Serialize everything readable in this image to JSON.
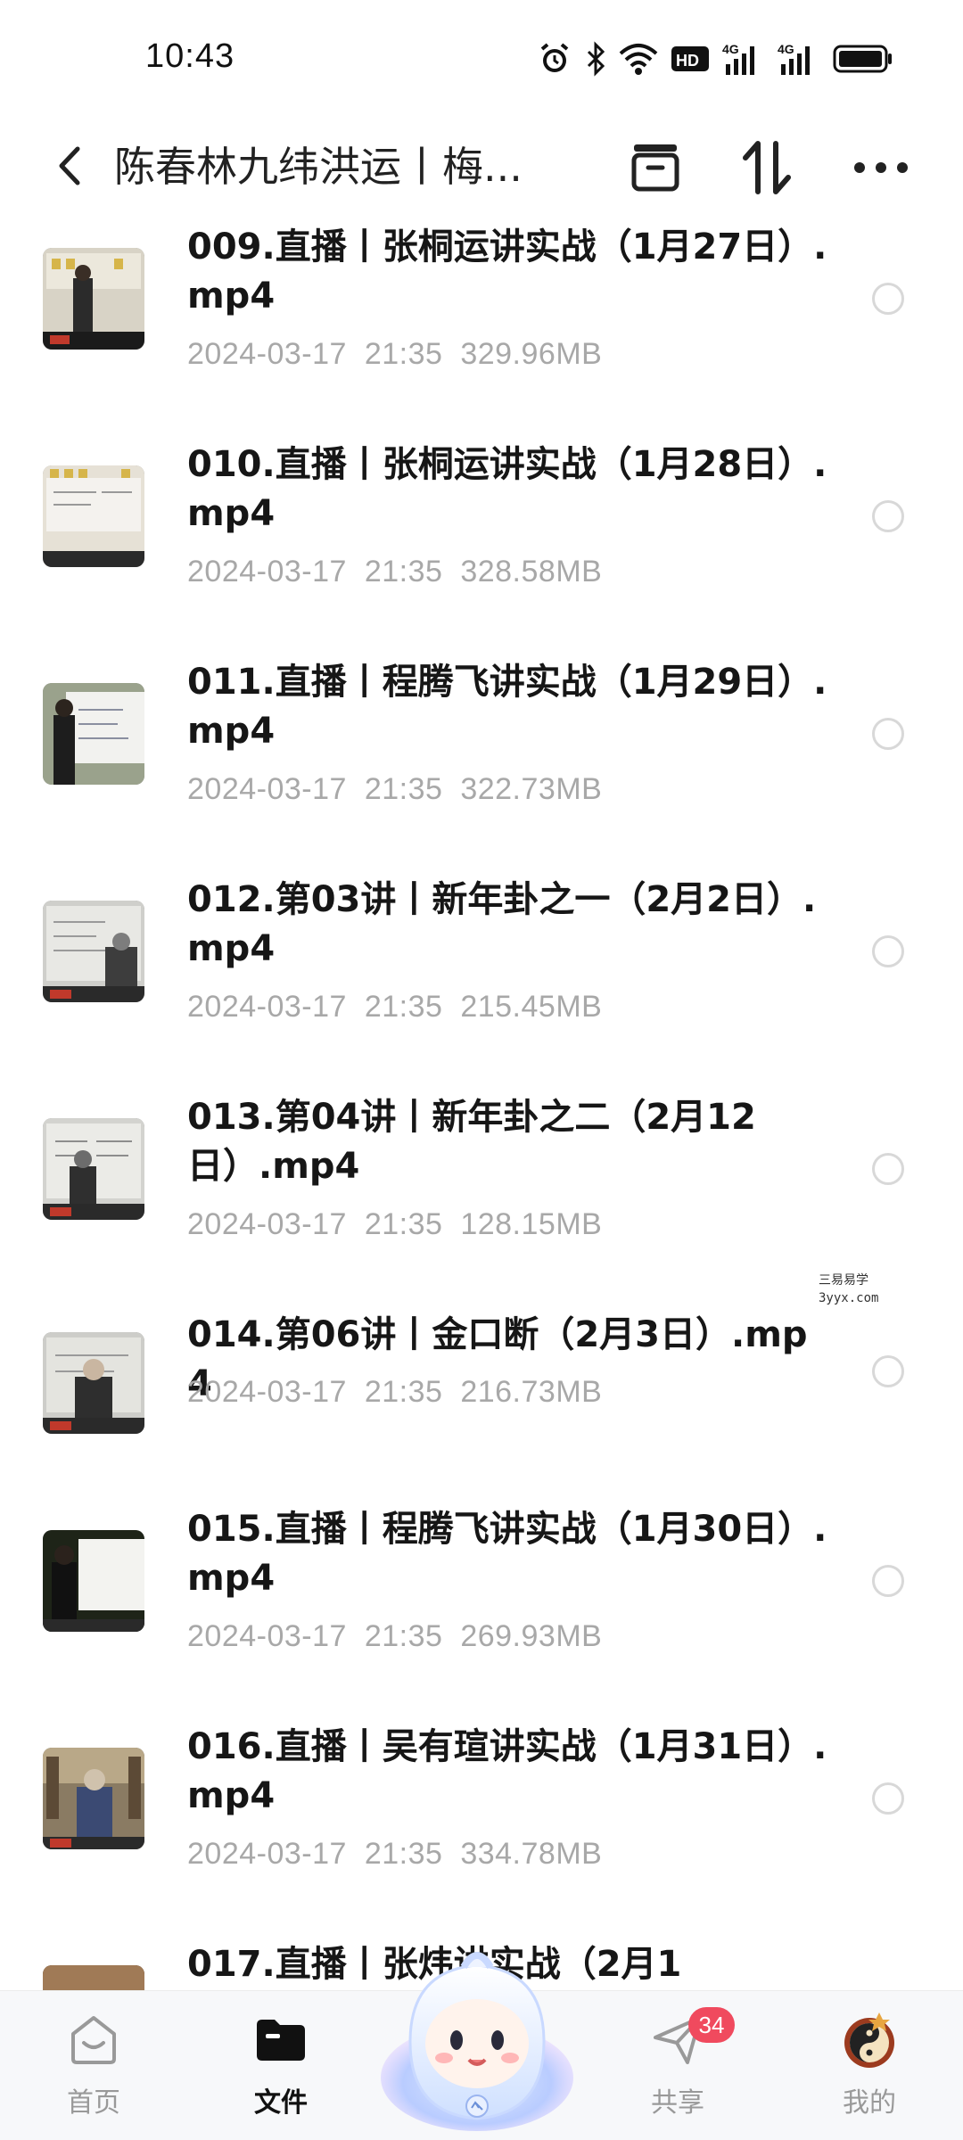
{
  "status_bar": {
    "time": "10:43",
    "icons": [
      "alarm-icon",
      "bluetooth-icon",
      "wifi-icon",
      "hd-icon",
      "signal-4g-icon",
      "signal-4g-icon",
      "battery-icon"
    ]
  },
  "header": {
    "title": "陈春林九纬洪运丨梅...",
    "icons": [
      "back-icon",
      "archive-icon",
      "sort-icon",
      "more-icon"
    ]
  },
  "files": [
    {
      "name": "009.直播丨张桐运讲实战（1月27日）.mp4",
      "date": "2024-03-17",
      "time": "21:35",
      "size": "329.96MB"
    },
    {
      "name": "010.直播丨张桐运讲实战（1月28日）.mp4",
      "date": "2024-03-17",
      "time": "21:35",
      "size": "328.58MB"
    },
    {
      "name": "011.直播丨程腾飞讲实战（1月29日）.mp4",
      "date": "2024-03-17",
      "time": "21:35",
      "size": "322.73MB"
    },
    {
      "name": "012.第03讲丨新年卦之一（2月2日）.mp4",
      "date": "2024-03-17",
      "time": "21:35",
      "size": "215.45MB"
    },
    {
      "name": "013.第04讲丨新年卦之二（2月12日）.mp4",
      "date": "2024-03-17",
      "time": "21:35",
      "size": "128.15MB"
    },
    {
      "name": "014.第06讲丨金口断（2月3日）.mp4",
      "date": "2024-03-17",
      "time": "21:35",
      "size": "216.73MB"
    },
    {
      "name": "015.直播丨程腾飞讲实战（1月30日）.mp4",
      "date": "2024-03-17",
      "time": "21:35",
      "size": "269.93MB"
    },
    {
      "name": "016.直播丨吴有瑄讲实战（1月31日）.mp4",
      "date": "2024-03-17",
      "time": "21:35",
      "size": "334.78MB"
    },
    {
      "name": "017.直播丨张炜",
      "date": "",
      "time": "",
      "size": ""
    }
  ],
  "partial_file_tail": "讲实战（2月1",
  "watermark": {
    "line1": "三易易学",
    "line2": "3yyx.com"
  },
  "bottom_nav": {
    "items": [
      {
        "label": "首页",
        "icon": "home-icon"
      },
      {
        "label": "文件",
        "icon": "folder-icon"
      },
      {
        "label": "",
        "icon": "assistant-mascot-icon"
      },
      {
        "label": "共享",
        "icon": "share-send-icon",
        "badge": "34"
      },
      {
        "label": "我的",
        "icon": "profile-avatar-icon"
      }
    ]
  }
}
